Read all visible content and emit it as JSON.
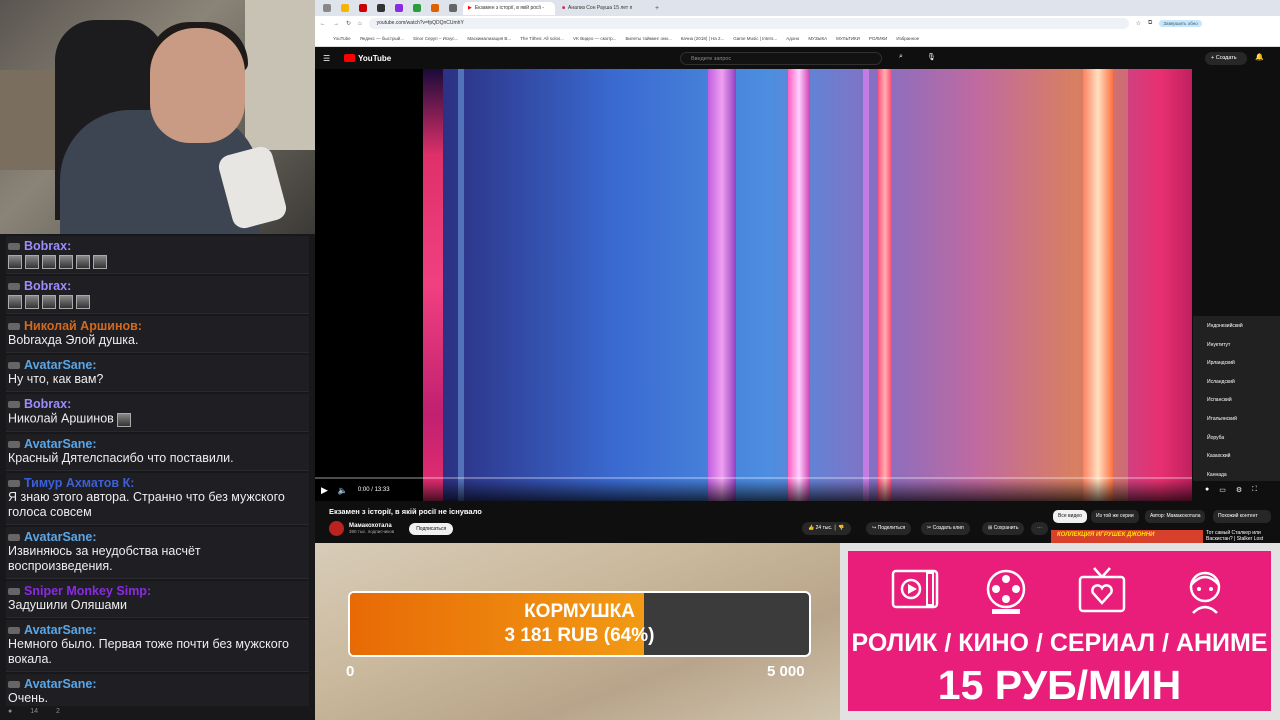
{
  "chat": {
    "messages": [
      {
        "user": "Bobrax:",
        "color": "#9b8cff",
        "text": "",
        "emotes": 6
      },
      {
        "user": "Bobrax:",
        "color": "#9b8cff",
        "text": "",
        "emotes": 5
      },
      {
        "user": "Николай Аршинов:",
        "color": "#d2691e",
        "text": "Bobraxда Элой душка.",
        "emotes": 0
      },
      {
        "user": "AvatarSane:",
        "color": "#5aa6e6",
        "text": "Ну что, как вам?",
        "emotes": 0
      },
      {
        "user": "Bobrax:",
        "color": "#9b8cff",
        "text": "Николай Аршинов",
        "emotes": 1
      },
      {
        "user": "AvatarSane:",
        "color": "#5aa6e6",
        "text": "Красный Дятелспасибо что поставили.",
        "emotes": 0
      },
      {
        "user": "Тимур Ахматов К:",
        "color": "#3b5fd8",
        "text": "Я знаю этого автора. Странно что без мужского голоса совсем",
        "emotes": 0
      },
      {
        "user": "AvatarSane:",
        "color": "#5aa6e6",
        "text": "Извиняюсь за неудобства насчёт воспроизведения.",
        "emotes": 0
      },
      {
        "user": "Sniper Monkey Simp:",
        "color": "#8a2be2",
        "text": "Задушили Оляшами",
        "emotes": 0
      },
      {
        "user": "AvatarSane:",
        "color": "#5aa6e6",
        "text": "Немного было. Первая тоже почти без мужского вокала.",
        "emotes": 0
      },
      {
        "user": "AvatarSane:",
        "color": "#5aa6e6",
        "text": "Очень.",
        "emotes": 0
      }
    ],
    "footer": {
      "viewers": "14",
      "count": "2"
    }
  },
  "browser": {
    "tabs": [
      {
        "label": "Екзамен з історії, в якій росії -",
        "active": true
      },
      {
        "label": "Анализ Сон Рауша 15 лет п",
        "active": false
      }
    ],
    "url": "youtube.com/watch?v=fpQDQnCUmhY",
    "bookmarks": [
      "YouTube",
      "Яндекс — быстрый...",
      "Sinor Серуп – Искус...",
      "Маскимализация B...",
      "The Tithes: All solos...",
      "VK Видео — смотр...",
      "Билеты тайминг они...",
      "Качна (2018) | На 2...",
      "Game Music | Inters...",
      "Адоно",
      "МУЗЫКА",
      "МУЛЬТИКИ",
      "РОЛИКИ",
      "Избранное"
    ],
    "profile_btn": "Завершить обно"
  },
  "youtube": {
    "logo": "YouTube",
    "search_placeholder": "Введите запрос",
    "create": "Создать",
    "time": "0:00 / 13:33",
    "video_title": "Екзамен з історії, в якій росії не існувало",
    "channel": "Мамакохотала",
    "subs": "390 тыс. подписчиков",
    "subscribe": "Подписаться",
    "likes": "24 тыс.",
    "share": "Поделиться",
    "clip": "Создать клип",
    "save": "Сохранить",
    "chips": [
      "Все видео",
      "Из той же серии",
      "Автор: Мамакохотала",
      "Похожий контент"
    ],
    "rec_thumb": "КОЛЛЕКЦИЯ ИГРУШЕК ДЖОННИ",
    "rec_title": "Тот самый Сталкер или Васкистан? | Stalker Lost",
    "languages": [
      "Индонезийский",
      "Инуктитут",
      "Ирландский",
      "Исландский",
      "Испанский",
      "Итальянский",
      "Йоруба",
      "Казахский",
      "Каннада"
    ]
  },
  "goal": {
    "title": "КОРМУШКА",
    "amount": "3 181 RUB (64%)",
    "progress": 0.64,
    "min": "0",
    "max": "5 000"
  },
  "promo": {
    "line1": "РОЛИК / КИНО / СЕРИАЛ / АНИМЕ",
    "line2": "15 РУБ/МИН",
    "icons": [
      "video-icon",
      "film-reel-icon",
      "tv-icon",
      "anime-girl-icon"
    ]
  }
}
